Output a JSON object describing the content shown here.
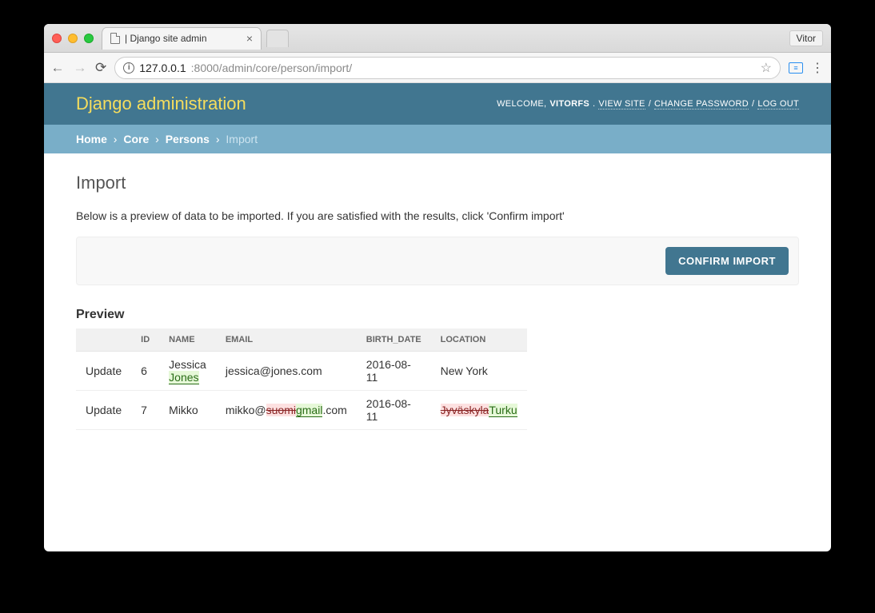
{
  "browser": {
    "tab_title": " | Django site admin",
    "profile": "Vitor",
    "url_host": "127.0.0.1",
    "url_port_path": ":8000/admin/core/person/import/"
  },
  "header": {
    "brand": "Django administration",
    "welcome": "WELCOME,",
    "username": "VITORFS",
    "view_site": "VIEW SITE",
    "change_password": "CHANGE PASSWORD",
    "logout": "LOG OUT"
  },
  "breadcrumbs": {
    "home": "Home",
    "app": "Core",
    "model": "Persons",
    "current": "Import"
  },
  "page": {
    "title": "Import",
    "intro": "Below is a preview of data to be imported. If you are satisfied with the results, click 'Confirm import'",
    "confirm_label": "CONFIRM IMPORT",
    "preview_heading": "Preview"
  },
  "table": {
    "headers": {
      "action": "",
      "id": "ID",
      "name": "NAME",
      "email": "EMAIL",
      "birth_date": "BIRTH_DATE",
      "location": "LOCATION"
    },
    "rows": [
      {
        "action": "Update",
        "id": "6",
        "name_old": "Jessica",
        "name_ins": " Jones",
        "email_pre": "jessica@jones.com",
        "email_del": "",
        "email_ins": "",
        "email_post": "",
        "birth_date": "2016-08-11",
        "loc_del": "",
        "loc_ins": "",
        "loc_plain": "New York"
      },
      {
        "action": "Update",
        "id": "7",
        "name_old": "Mikko",
        "name_ins": "",
        "email_pre": "mikko@",
        "email_del": "suomi",
        "email_ins": "gmail",
        "email_post": ".com",
        "birth_date": "2016-08-11",
        "loc_del": "Jyväskyla",
        "loc_ins": "Turku",
        "loc_plain": ""
      }
    ]
  }
}
